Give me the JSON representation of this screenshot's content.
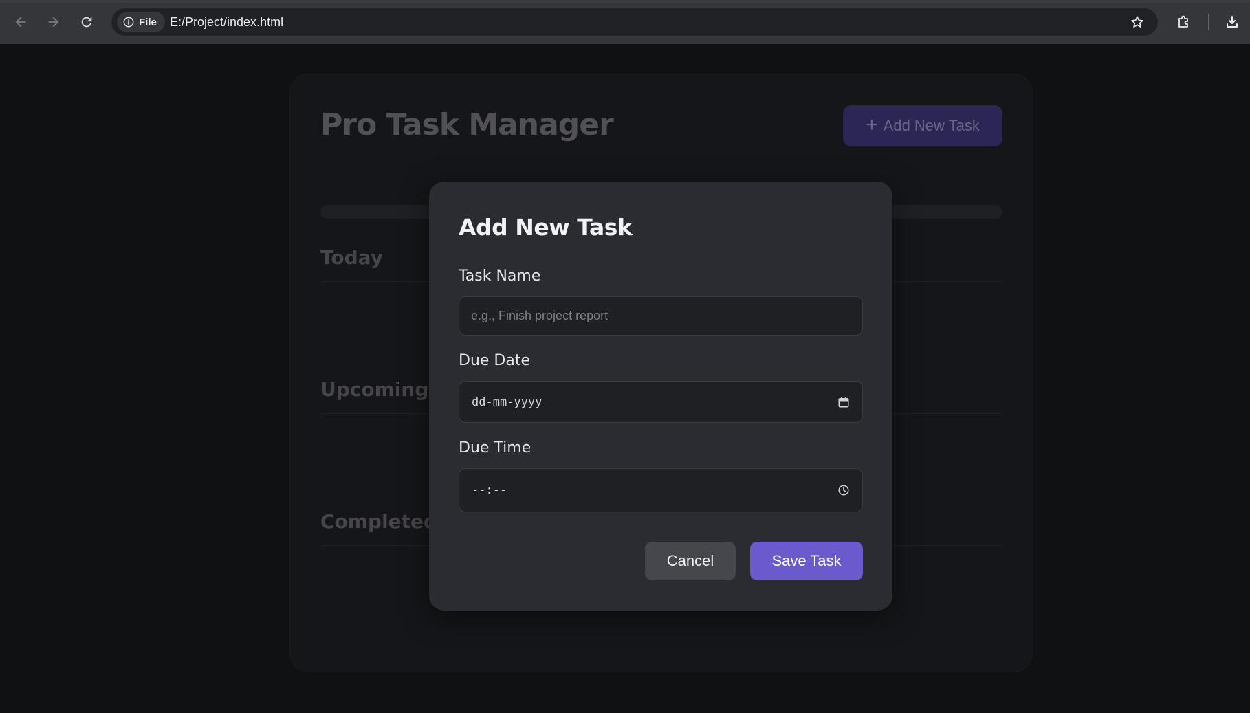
{
  "browser": {
    "file_chip": "File",
    "url": "E:/Project/index.html"
  },
  "app": {
    "title": "Pro Task Manager",
    "add_button": "Add New Task",
    "sections": [
      "Today",
      "Upcoming",
      "Completed"
    ]
  },
  "modal": {
    "title": "Add New Task",
    "task_name_label": "Task Name",
    "task_name_placeholder": "e.g., Finish project report",
    "due_date_label": "Due Date",
    "due_date_value": "dd-mm-yyyy",
    "due_time_label": "Due Time",
    "due_time_value": "--:--",
    "cancel_label": "Cancel",
    "save_label": "Save Task"
  },
  "colors": {
    "accent": "#6a5acd",
    "modal_bg": "#2b2c31",
    "page_bg": "#16171a"
  }
}
